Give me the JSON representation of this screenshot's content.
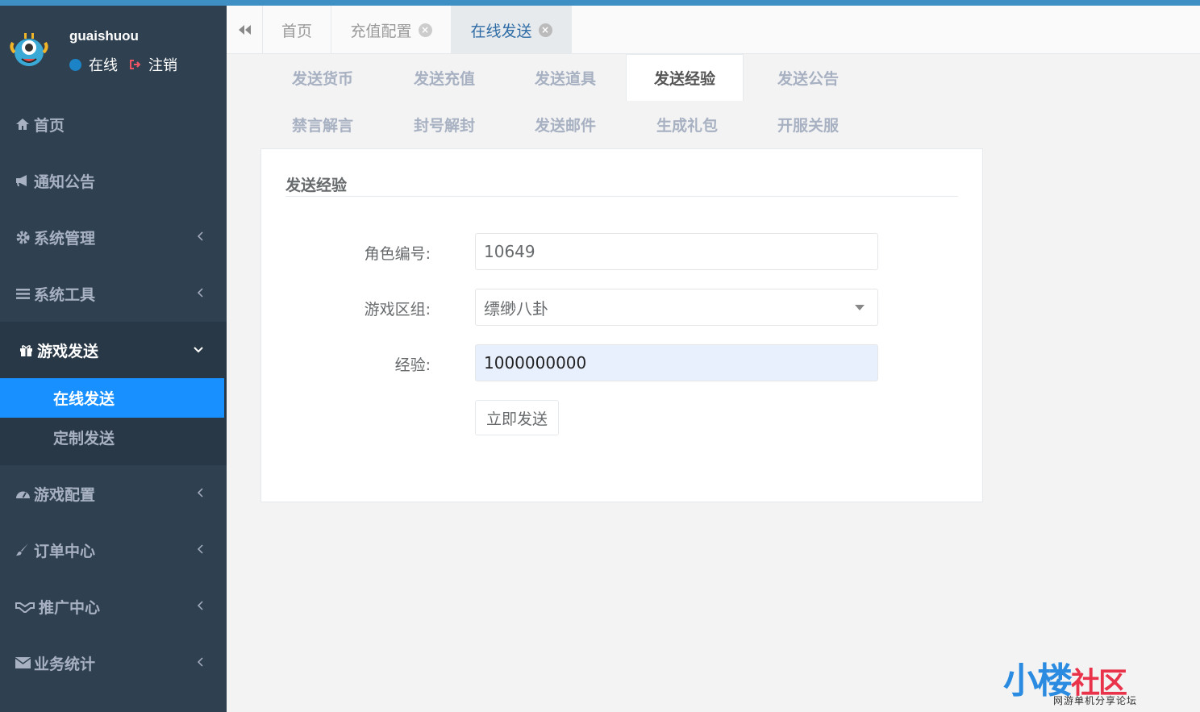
{
  "profile": {
    "username": "guaishuou",
    "status": "在线",
    "logout": "注销"
  },
  "sidebar": {
    "items": [
      {
        "label": "首页",
        "icon": "home-icon"
      },
      {
        "label": "通知公告",
        "icon": "bullhorn-icon"
      },
      {
        "label": "系统管理",
        "icon": "gear-icon"
      },
      {
        "label": "系统工具",
        "icon": "bars-icon"
      },
      {
        "label": "游戏发送",
        "icon": "gift-icon"
      },
      {
        "label": "游戏配置",
        "icon": "dashboard-icon"
      },
      {
        "label": "订单中心",
        "icon": "brush-icon"
      },
      {
        "label": "推广中心",
        "icon": "handshake-icon"
      },
      {
        "label": "业务统计",
        "icon": "envelope-icon"
      }
    ],
    "sub_items": [
      "在线发送",
      "定制发送"
    ]
  },
  "tabs": [
    {
      "label": "首页"
    },
    {
      "label": "充值配置"
    },
    {
      "label": "在线发送"
    }
  ],
  "subtabs": [
    "发送货币",
    "发送充值",
    "发送道具",
    "发送经验",
    "发送公告",
    "禁言解言",
    "封号解封",
    "发送邮件",
    "生成礼包",
    "开服关服"
  ],
  "form": {
    "title": "发送经验",
    "role_label": "角色编号:",
    "role_value": "10649",
    "zone_label": "游戏区组:",
    "zone_value": "缥缈八卦",
    "exp_label": "经验:",
    "exp_value": "1000000000",
    "submit": "立即发送"
  },
  "watermark": {
    "main_blue": "小楼",
    "main_red": "社区",
    "sub": "网游单机分享论坛"
  },
  "colors": {
    "sidebar": "#2f4050",
    "accent": "#1890ff",
    "top_stripe": "#3d8fc4"
  }
}
